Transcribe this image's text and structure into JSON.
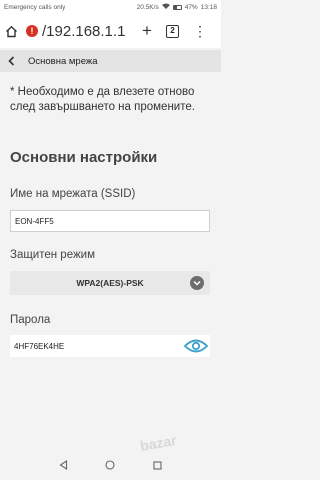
{
  "status_bar": {
    "left_text": "Emergency calls only",
    "speed": "20.5K/s",
    "battery": "47%",
    "time": "13:18"
  },
  "browser": {
    "url": "/192.168.1.1",
    "tab_count": "2"
  },
  "page": {
    "header_title": "Основна мрежа",
    "notice": "* Необходимо е да влезете отново след завършването на промените.",
    "section_title": "Основни настройки",
    "ssid_label": "Име на мрежата (SSID)",
    "ssid_value": "EON-4FF5",
    "security_label": "Защитен режим",
    "security_value": "WPA2(AES)-PSK",
    "password_label": "Парола",
    "password_value": "4HF76EK4HE"
  },
  "watermark": "bazar",
  "colors": {
    "accent": "#3ba0c9",
    "insecure": "#d93025",
    "header_bg": "#e4e4e4",
    "page_bg": "#f3f3f3"
  }
}
